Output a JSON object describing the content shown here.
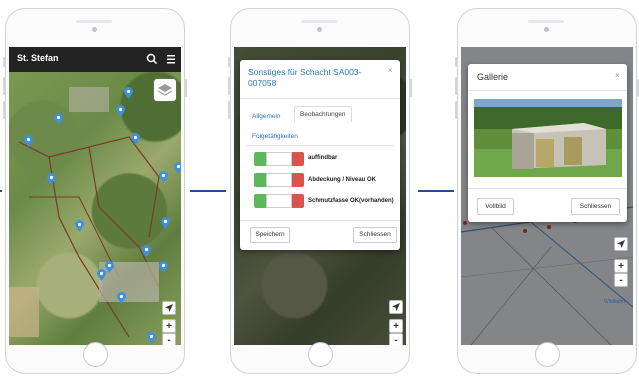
{
  "screen1": {
    "title": "St. Stefan",
    "icons": [
      "search-icon",
      "menu-icon",
      "layers-icon",
      "locate-icon"
    ],
    "zoom_in": "+",
    "zoom_out": "-"
  },
  "screen2": {
    "modal_title": "Sonstiges für Schacht SA003-007058",
    "close": "×",
    "tabs": [
      "Allgemein",
      "Beobachtungen",
      "Folgetätigkeiten"
    ],
    "active_tab": "Beobachtungen",
    "observations": [
      {
        "label": "auffindbar"
      },
      {
        "label": "Abdeckung / Niveau OK"
      },
      {
        "label": "Schmutzfasse OK(vorhanden)"
      }
    ],
    "save_button": "Speichern",
    "close_button": "Schliessen",
    "zoom_in": "+",
    "zoom_out": "-"
  },
  "screen3": {
    "modal_title": "Gallerie",
    "close": "×",
    "full_button": "Vollbild",
    "close_button": "Schliessen",
    "map_label": "Wildbahn",
    "zoom_in": "+",
    "zoom_out": "-"
  },
  "colors": {
    "accent": "#2a7ab8",
    "topbar": "#232323",
    "pin": "#3d8fe0",
    "toggle_green": "#5cb85c",
    "toggle_red": "#d9534f",
    "connector": "#1f4f8e"
  }
}
